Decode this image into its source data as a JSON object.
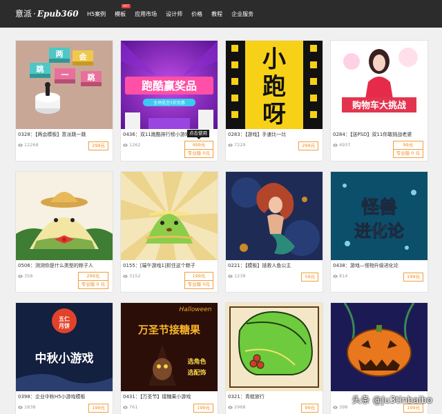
{
  "header": {
    "logo_cn": "意派",
    "logo_dot": "·",
    "logo_en": "Epub360",
    "nav": [
      {
        "label": "H5案例"
      },
      {
        "label": "模板",
        "badge": "HOT"
      },
      {
        "label": "应用市场"
      },
      {
        "label": "设计师"
      },
      {
        "label": "价格"
      },
      {
        "label": "教程"
      },
      {
        "label": "企业服务"
      }
    ]
  },
  "cards": [
    {
      "title": "0328：【两会模板】意派跳一跳",
      "views": "12268",
      "price": "299元",
      "thumb_text": [
        "两",
        "会",
        "跳",
        "一",
        "跳"
      ]
    },
    {
      "title": "0436：双11跑酷排行榜小游戏",
      "views": "1262",
      "price": "499元",
      "pro_price": "专业版 0元",
      "thumb_text": [
        "跑酷赢奖品",
        "全场低至5折优惠"
      ],
      "tooltip": "点击使用"
    },
    {
      "title": "0283：【游戏】手速比一比",
      "views": "7229",
      "price": "299元",
      "thumb_text": [
        "小",
        "跑",
        "呀"
      ]
    },
    {
      "title": "0284：【送PSD】双11你敢挑战老婆",
      "views": "4937",
      "price": "99元",
      "pro_price": "专业版 0 元",
      "thumb_text": [
        "购物车大挑战"
      ]
    },
    {
      "title": "0506：测测你是什么类型的粽子人",
      "views": "358",
      "price": "299元",
      "pro_price": "专业版 0 元"
    },
    {
      "title": "0155：[端午游戏1]抓住这个粽子",
      "views": "3152",
      "price": "199元",
      "pro_price": "专业版 0元"
    },
    {
      "title": "0221：【模板】拯救人鱼公主",
      "views": "1238",
      "price": "59元"
    },
    {
      "title": "0438：游戏—怪物升级进化论",
      "views": "814",
      "price": "199元",
      "thumb_text": [
        "怪兽",
        "进化论"
      ]
    },
    {
      "title": "0398：企业中秋H5小游戏模板",
      "views": "1838",
      "price": "199元",
      "thumb_text": [
        "五仁",
        "月饼",
        "中秋小游戏"
      ]
    },
    {
      "title": "0431：【万圣节】接糖果小游戏",
      "views": "761",
      "price": "199元",
      "thumb_text": [
        "Halloween",
        "万圣节接糖果",
        "选角色",
        "选配饰"
      ]
    },
    {
      "title": "0321：青蛙旅行",
      "views": "2968",
      "price": "99元"
    },
    {
      "title": "",
      "views": "398",
      "price": "199元"
    }
  ],
  "watermark": "头条 @Ju3tinbaibo",
  "colors": {
    "topbar": "#2c2c2c",
    "price": "#f08a1c",
    "badge": "#e73a3a"
  }
}
